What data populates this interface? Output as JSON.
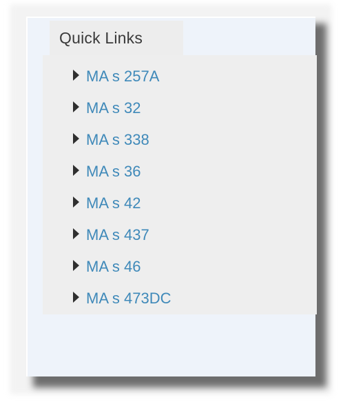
{
  "quick_links": {
    "title": "Quick Links",
    "icon": "caret-right-icon",
    "link_color": "#3f89b9",
    "items": [
      {
        "label": "MA s 257A"
      },
      {
        "label": "MA s 32"
      },
      {
        "label": "MA s 338"
      },
      {
        "label": "MA s 36"
      },
      {
        "label": "MA s 42"
      },
      {
        "label": "MA s 437"
      },
      {
        "label": "MA s 46"
      },
      {
        "label": "MA s 473DC"
      }
    ]
  }
}
